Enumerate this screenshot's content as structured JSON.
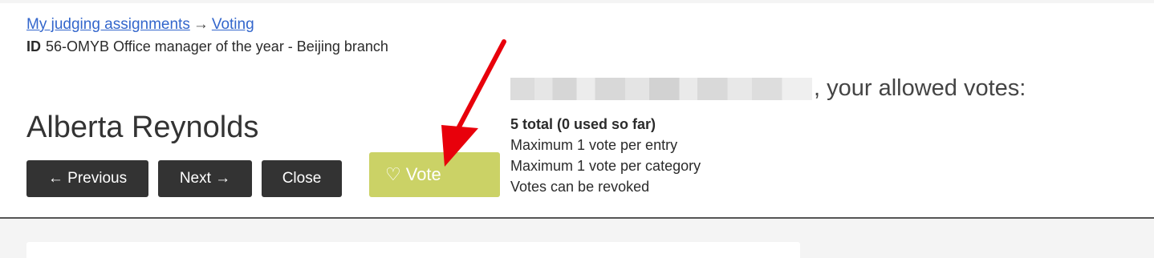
{
  "breadcrumb": {
    "link1": "My judging assignments",
    "separator": "→",
    "link2": "Voting"
  },
  "entry": {
    "id_label": "ID",
    "id_text": "56-OMYB Office manager of the year - Beijing branch",
    "name": "Alberta Reynolds"
  },
  "buttons": {
    "previous": "← Previous",
    "next": "Next →",
    "close": "Close",
    "vote": "Vote",
    "vote_icon": "heart-icon"
  },
  "votes": {
    "heading_suffix": ", your allowed votes:",
    "total": "5 total (0 used so far)",
    "rules": [
      "Maximum 1 vote per entry",
      "Maximum 1 vote per category",
      "Votes can be revoked"
    ]
  },
  "colors": {
    "vote_button": "#cbd266",
    "nav_button": "#333333",
    "link": "#3366cc",
    "annotation_arrow": "#e8000b"
  }
}
